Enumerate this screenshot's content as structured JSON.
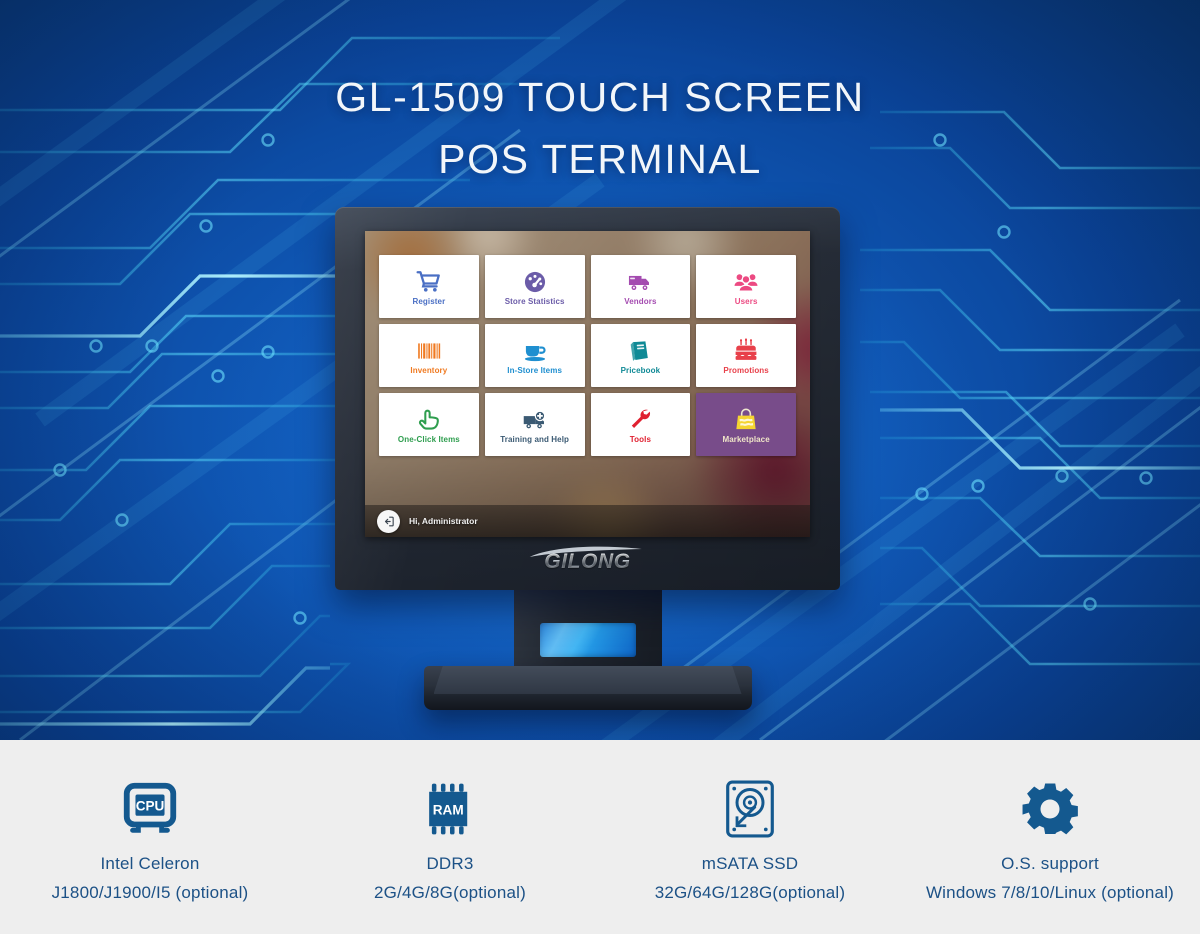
{
  "hero": {
    "title_line1": "GL-1509 TOUCH SCREEN",
    "title_line2": "POS TERMINAL",
    "background": "#0b4694",
    "circuit_color": "#3fd0f0"
  },
  "device": {
    "brand_logo": "GILONG",
    "bezel_color": "#262c37",
    "status_bar": {
      "logout_icon": "logout-arrow-icon",
      "greeting": "Hi, Administrator"
    },
    "screen": {
      "tiles": [
        {
          "label": "Register",
          "icon": "shopping-cart-icon",
          "color": "#4a6fc4",
          "bg": "#ffffff",
          "text_color": "#4a6fc4"
        },
        {
          "label": "Store Statistics",
          "icon": "speedometer-icon",
          "color": "#6b5ca8",
          "bg": "#ffffff",
          "text_color": "#6b5ca8"
        },
        {
          "label": "Vendors",
          "icon": "delivery-truck-icon",
          "color": "#a44bb0",
          "bg": "#ffffff",
          "text_color": "#a44bb0"
        },
        {
          "label": "Users",
          "icon": "users-group-icon",
          "color": "#ec4a82",
          "bg": "#ffffff",
          "text_color": "#ec4a82"
        },
        {
          "label": "Inventory",
          "icon": "barcode-icon",
          "color": "#f07a21",
          "bg": "#ffffff",
          "text_color": "#f07a21"
        },
        {
          "label": "In-Store Items",
          "icon": "coffee-cup-icon",
          "color": "#1f8fd0",
          "bg": "#ffffff",
          "text_color": "#1f8fd0"
        },
        {
          "label": "Pricebook",
          "icon": "book-icon",
          "color": "#108a96",
          "bg": "#ffffff",
          "text_color": "#108a96"
        },
        {
          "label": "Promotions",
          "icon": "birthday-cake-icon",
          "color": "#e8404a",
          "bg": "#ffffff",
          "text_color": "#e8404a"
        },
        {
          "label": "One-Click Items",
          "icon": "pointing-hand-icon",
          "color": "#2f9e4f",
          "bg": "#ffffff",
          "text_color": "#2f9e4f"
        },
        {
          "label": "Training and Help",
          "icon": "ambulance-icon",
          "color": "#3b5a73",
          "bg": "#ffffff",
          "text_color": "#3b5a73"
        },
        {
          "label": "Tools",
          "icon": "wrench-icon",
          "color": "#e02030",
          "bg": "#ffffff",
          "text_color": "#e02030"
        },
        {
          "label": "Marketplace",
          "icon": "shopping-bag-icon",
          "color": "#f5d431",
          "bg": "#784c8a",
          "text_color": "#f0e6c8"
        }
      ]
    }
  },
  "specs": [
    {
      "icon": "cpu-icon",
      "title": "Intel Celeron",
      "value": "J1800/J1900/I5 (optional)"
    },
    {
      "icon": "ram-icon",
      "title": "DDR3",
      "value": "2G/4G/8G(optional)"
    },
    {
      "icon": "ssd-icon",
      "title": "mSATA SSD",
      "value": "32G/64G/128G(optional)"
    },
    {
      "icon": "gear-icon",
      "title": "O.S. support",
      "value": "Windows 7/8/10/Linux (optional)"
    }
  ],
  "spec_text_color": "#1c5186",
  "spec_band_bg": "#eeeeee"
}
